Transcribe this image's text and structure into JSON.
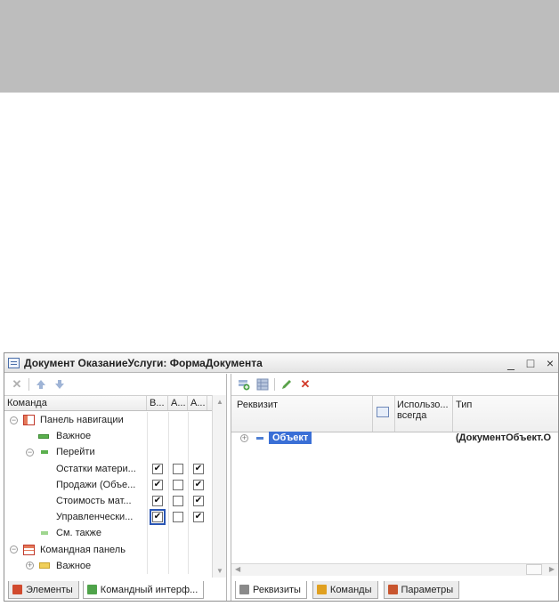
{
  "window": {
    "title": "Документ ОказаниеУслуги: ФормаДокумента",
    "controls": {
      "minimize": "_",
      "maximize": "□",
      "close": "×"
    }
  },
  "left_panel": {
    "toolbar": {
      "icons": [
        "delete-icon",
        "move-up-icon",
        "move-down-icon"
      ]
    },
    "columns": [
      "Команда",
      "В...",
      "А...",
      "А..."
    ],
    "rows": [
      {
        "label": "Панель навигации",
        "level": 0,
        "expander": "⊖",
        "icon": "nav-panel-icon"
      },
      {
        "label": "Важное",
        "level": 1,
        "icon": "group-green-icon"
      },
      {
        "label": "Перейти",
        "level": 1,
        "expander": "⊖",
        "icon": "group-green-icon"
      },
      {
        "label": "Остатки матери...",
        "level": 2,
        "checks": [
          "✔",
          "",
          "✔"
        ]
      },
      {
        "label": "Продажи (Объе...",
        "level": 2,
        "checks": [
          "✔",
          "",
          "✔"
        ]
      },
      {
        "label": "Стоимость мат...",
        "level": 2,
        "checks": [
          "✔",
          "",
          "✔"
        ]
      },
      {
        "label": "Управленчески...",
        "level": 2,
        "checks": [
          "✔",
          "",
          "✔"
        ],
        "selected": true
      },
      {
        "label": "См. также",
        "level": 1,
        "icon": "group-light-icon"
      },
      {
        "label": "Командная панель",
        "level": 0,
        "expander": "⊖",
        "icon": "command-panel-icon"
      },
      {
        "label": "Важное",
        "level": 1,
        "expander": "⊕",
        "icon": "group-yellow-icon"
      }
    ],
    "tabs": [
      {
        "label": "Элементы",
        "icon_color": "#d14a2e",
        "active": false
      },
      {
        "label": "Командный интерф...",
        "icon_color": "#4fa34a",
        "active": true
      }
    ]
  },
  "right_panel": {
    "toolbar": {
      "icons": [
        "add-attribute-icon",
        "add-table-icon",
        "edit-icon",
        "delete-icon"
      ]
    },
    "columns": [
      "Реквизит",
      "Использо... всегда",
      "Тип"
    ],
    "rows": [
      {
        "expander": "⊕",
        "name": "Объект",
        "type": "(ДокументОбъект.О"
      }
    ],
    "tabs": [
      {
        "label": "Реквизиты",
        "icon_color": "#8a8a8a"
      },
      {
        "label": "Команды",
        "icon_color": "#e0a020"
      },
      {
        "label": "Параметры",
        "icon_color": "#c8552e"
      }
    ]
  },
  "colors": {
    "top_band": "#bdbdbd",
    "selection": "#3a6fd6",
    "window_border": "#8f8f8f"
  }
}
